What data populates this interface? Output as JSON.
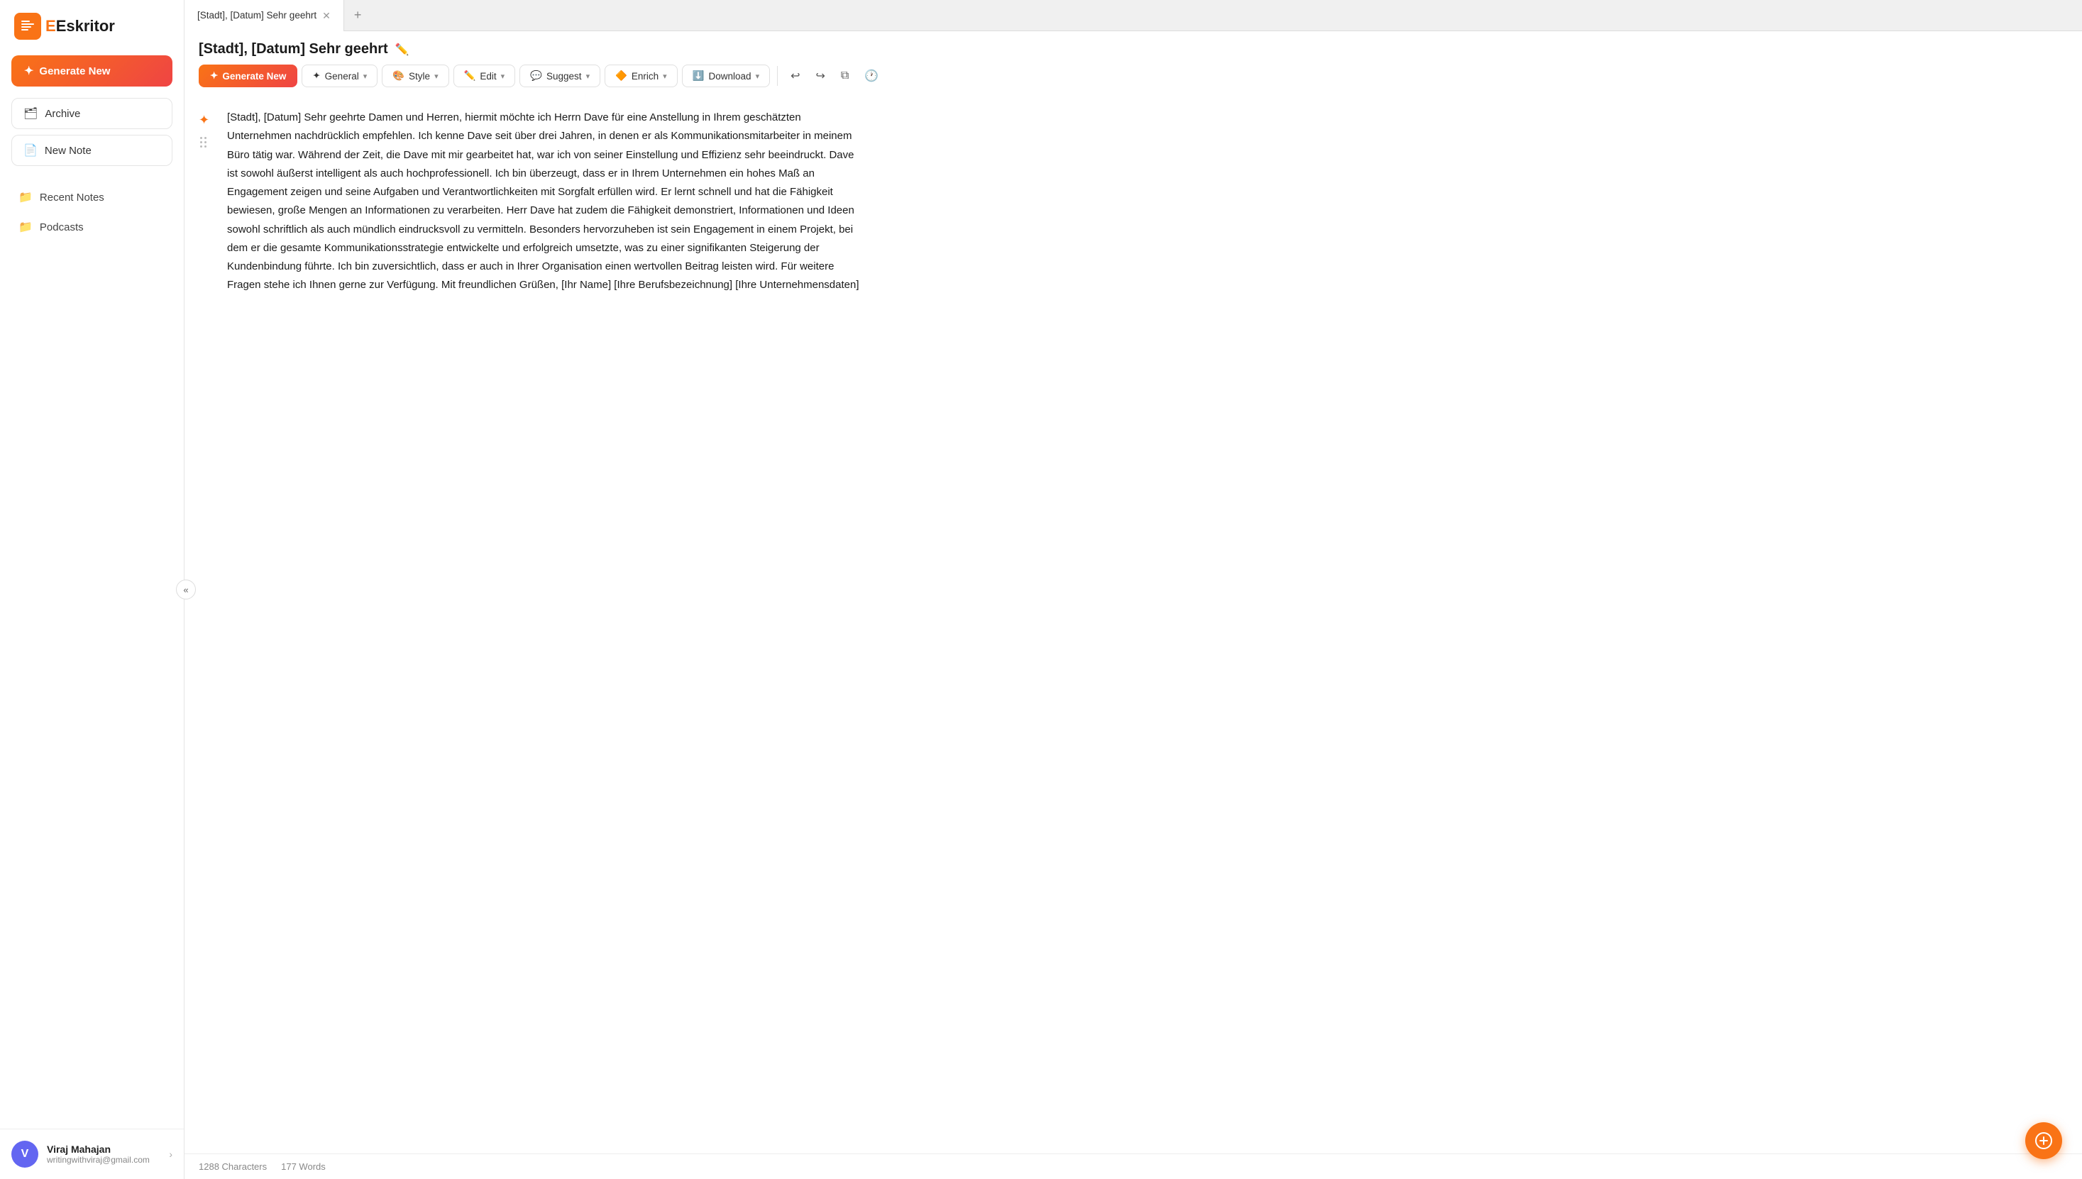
{
  "app": {
    "name": "Eskritor",
    "logo_letter": "E"
  },
  "sidebar": {
    "generate_btn": "Generate New",
    "archive_btn": "Archive",
    "new_note_btn": "New Note",
    "nav_items": [
      {
        "id": "recent-notes",
        "label": "Recent Notes",
        "icon": "folder"
      },
      {
        "id": "podcasts",
        "label": "Podcasts",
        "icon": "folder"
      }
    ],
    "collapse_label": "«"
  },
  "user": {
    "initial": "V",
    "name": "Viraj Mahajan",
    "email": "writingwithviraj@gmail.com"
  },
  "tabs": [
    {
      "label": "[Stadt], [Datum] Sehr geehrt",
      "active": true
    }
  ],
  "tab_add": "+",
  "document": {
    "title": "[Stadt], [Datum] Sehr geehrt",
    "content": "[Stadt], [Datum] Sehr geehrte Damen und Herren, hiermit möchte ich Herrn Dave für eine Anstellung in Ihrem geschätzten Unternehmen nachdrücklich empfehlen. Ich kenne Dave seit über drei Jahren, in denen er als Kommunikationsmitarbeiter in meinem Büro tätig war. Während der Zeit, die Dave mit mir gearbeitet hat, war ich von seiner Einstellung und Effizienz sehr beeindruckt. Dave ist sowohl äußerst intelligent als auch hochprofessionell. Ich bin überzeugt, dass er in Ihrem Unternehmen ein hohes Maß an Engagement zeigen und seine Aufgaben und Verantwortlichkeiten mit Sorgfalt erfüllen wird. Er lernt schnell und hat die Fähigkeit bewiesen, große Mengen an Informationen zu verarbeiten. Herr Dave hat zudem die Fähigkeit demonstriert, Informationen und Ideen sowohl schriftlich als auch mündlich eindrucksvoll zu vermitteln. Besonders hervorzuheben ist sein Engagement in einem Projekt, bei dem er die gesamte Kommunikationsstrategie entwickelte und erfolgreich umsetzte, was zu einer signifikanten Steigerung der Kundenbindung führte. Ich bin zuversichtlich, dass er auch in Ihrer Organisation einen wertvollen Beitrag leisten wird. Für weitere Fragen stehe ich Ihnen gerne zur Verfügung. Mit freundlichen Grüßen, [Ihr Name] [Ihre Berufsbezeichnung] [Ihre Unternehmensdaten]"
  },
  "toolbar": {
    "generate_label": "Generate New",
    "general_label": "General",
    "style_label": "Style",
    "edit_label": "Edit",
    "suggest_label": "Suggest",
    "enrich_label": "Enrich",
    "download_label": "Download"
  },
  "status_bar": {
    "characters": "1288 Characters",
    "words": "177 Words"
  }
}
